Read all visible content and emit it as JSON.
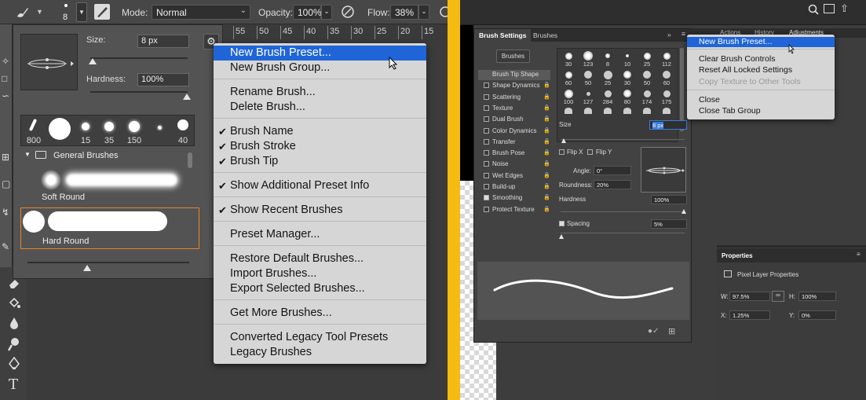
{
  "left": {
    "options": {
      "brush_size_value": "8",
      "mode_label": "Mode:",
      "mode_value": "Normal",
      "opacity_label": "Opacity:",
      "opacity_value": "100%",
      "flow_label": "Flow:",
      "flow_value": "38%"
    },
    "ruler_ticks": [
      "55",
      "50",
      "45",
      "40",
      "35",
      "30",
      "25",
      "20",
      "15"
    ],
    "picker": {
      "size_label": "Size:",
      "size_value": "8 px",
      "hardness_label": "Hardness:",
      "hardness_value": "100%",
      "recent": [
        {
          "label": "800"
        },
        {
          "label": ""
        },
        {
          "label": "15"
        },
        {
          "label": "35"
        },
        {
          "label": "150"
        },
        {
          "label": ""
        },
        {
          "label": "40"
        }
      ],
      "group_name": "General Brushes",
      "presets": [
        {
          "name": "Soft Round"
        },
        {
          "name": "Hard Round"
        }
      ]
    },
    "menu": {
      "items": [
        {
          "label": "New Brush Preset...",
          "checked": false,
          "highlighted": true
        },
        {
          "label": "New Brush Group...",
          "checked": false
        },
        {
          "label": "Rename Brush...",
          "checked": false
        },
        {
          "label": "Delete Brush...",
          "checked": false
        },
        {
          "label": "Brush Name",
          "checked": true
        },
        {
          "label": "Brush Stroke",
          "checked": true
        },
        {
          "label": "Brush Tip",
          "checked": true
        },
        {
          "label": "Show Additional Preset Info",
          "checked": true
        },
        {
          "label": "Show Recent Brushes",
          "checked": true
        },
        {
          "label": "Preset Manager...",
          "checked": false
        },
        {
          "label": "Restore Default Brushes...",
          "checked": false
        },
        {
          "label": "Import Brushes...",
          "checked": false
        },
        {
          "label": "Export Selected Brushes...",
          "checked": false
        },
        {
          "label": "Get More Brushes...",
          "checked": false
        },
        {
          "label": "Converted Legacy Tool Presets",
          "checked": false
        },
        {
          "label": "Legacy Brushes",
          "checked": false
        }
      ]
    }
  },
  "right": {
    "tabs": {
      "brush_settings": "Brush Settings",
      "brushes": "Brushes"
    },
    "top_tabs": {
      "actions": "Actions",
      "history": "History",
      "adjustments": "Adjustments"
    },
    "brushes_button": "Brushes",
    "options": [
      {
        "label": "Brush Tip Shape",
        "checked": null,
        "active": true
      },
      {
        "label": "Shape Dynamics",
        "checked": false
      },
      {
        "label": "Scattering",
        "checked": false
      },
      {
        "label": "Texture",
        "checked": false
      },
      {
        "label": "Dual Brush",
        "checked": false
      },
      {
        "label": "Color Dynamics",
        "checked": false
      },
      {
        "label": "Transfer",
        "checked": false
      },
      {
        "label": "Brush Pose",
        "checked": false
      },
      {
        "label": "Noise",
        "checked": false
      },
      {
        "label": "Wet Edges",
        "checked": false
      },
      {
        "label": "Build-up",
        "checked": false
      },
      {
        "label": "Smoothing",
        "checked": true
      },
      {
        "label": "Protect Texture",
        "checked": false
      }
    ],
    "tips": [
      "30",
      "123",
      "8",
      "10",
      "25",
      "112",
      "60",
      "50",
      "25",
      "30",
      "50",
      "60",
      "100",
      "127",
      "284",
      "80",
      "174",
      "175"
    ],
    "size_label": "Size",
    "size_value": "8 px",
    "flip_x": "Flip X",
    "flip_y": "Flip Y",
    "angle_label": "Angle:",
    "angle_value": "0°",
    "roundness_label": "Roundness:",
    "roundness_value": "20%",
    "hardness_label": "Hardness",
    "hardness_value": "100%",
    "spacing_label": "Spacing",
    "spacing_value": "5%",
    "menu": {
      "items": [
        {
          "label": "New Brush Preset...",
          "highlighted": true,
          "disabled": false
        },
        {
          "label": "Clear Brush Controls",
          "disabled": false
        },
        {
          "label": "Reset All Locked Settings",
          "disabled": false
        },
        {
          "label": "Copy Texture to Other Tools",
          "disabled": true
        },
        {
          "label": "Close",
          "disabled": false
        },
        {
          "label": "Close Tab Group",
          "disabled": false
        }
      ]
    },
    "properties": {
      "title": "Properties",
      "subtitle": "Pixel Layer Properties",
      "w_label": "W:",
      "w_value": "97.5%",
      "h_label": "H:",
      "h_value": "100%",
      "x_label": "X:",
      "x_value": "1.25%",
      "y_label": "Y:",
      "y_value": "0%"
    }
  },
  "colors": {
    "highlight": "#1f65d8",
    "divider": "#f4bb10"
  }
}
